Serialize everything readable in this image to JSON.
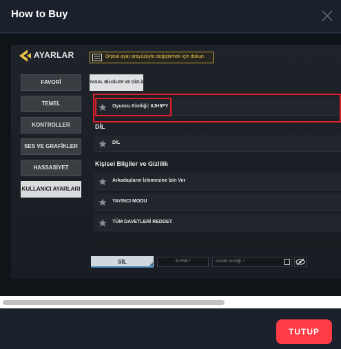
{
  "modal": {
    "title": "How to Buy",
    "close_icon": "close-icon",
    "footer_button": "TUTUP"
  },
  "game": {
    "header_title": "AYARLAR",
    "swap_hint": "Orjinal ayar arayüzüyle değiştirmek için dokun.",
    "sidebar": [
      {
        "label": "FAVORİ"
      },
      {
        "label": "TEMEL"
      },
      {
        "label": "KONTROLLER"
      },
      {
        "label": "SES VE GRAFİKLER"
      },
      {
        "label": "HASSASİYET"
      },
      {
        "label": "KULLANICI AYARLARI"
      }
    ],
    "active_tab": "YASAL BİLGİLER VE GİZLİLİK",
    "player_id_row": "Oyuncu Kimliği: 8JH9FY",
    "section_dil": "DİL",
    "dil_row": "DİL",
    "section_privacy": "Kişisel Bilgiler ve Gizlilik",
    "privacy_rows": [
      {
        "label": "Arkadaşların İzlemesine İzin Ver"
      },
      {
        "label": "YAYINCI MODU"
      },
      {
        "label": "TÜM DAVETLERİ REDDET"
      }
    ],
    "delete_button": "SİL",
    "id_field": "ID:F9K7",
    "privacy_field_placeholder": "Gizlilik Kimliği: *"
  },
  "colors": {
    "accent_red": "#ff3b46",
    "highlight_red": "#e11d2a",
    "game_gold": "#e8c24a"
  }
}
